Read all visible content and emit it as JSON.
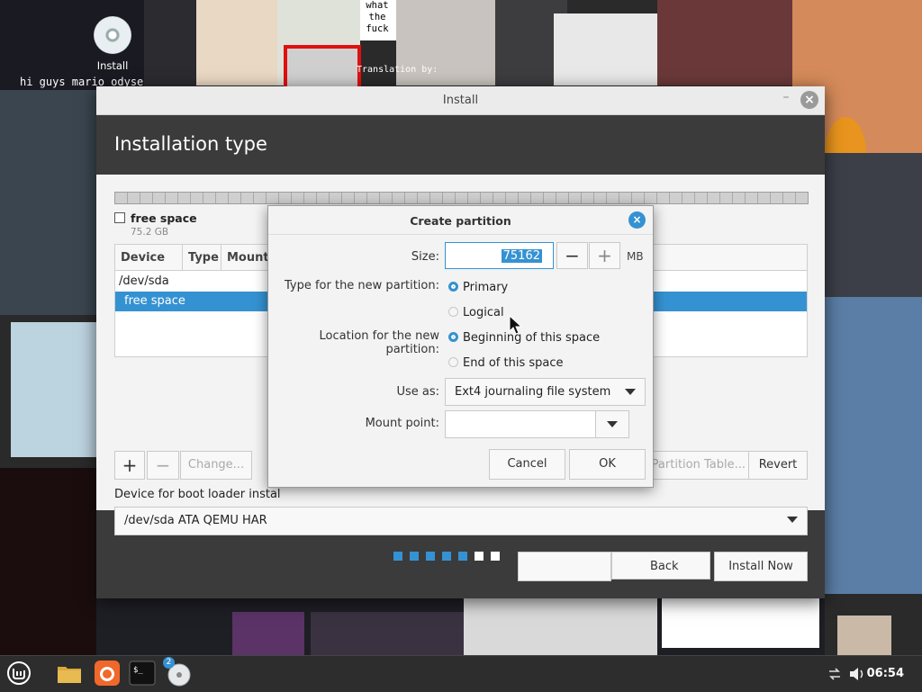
{
  "desktop": {
    "icon_label": "Install",
    "meme_text_1": "hi guys mario odyse",
    "meme_text_2": "what the fuck",
    "meme_text_3": "Translation by:"
  },
  "window": {
    "title": "Install",
    "minimize_glyph": "–",
    "close_glyph": "×",
    "page_title": "Installation type"
  },
  "partition": {
    "legend_name": "free space",
    "legend_size": "75.2 GB",
    "columns": [
      "Device",
      "Type",
      "Mount"
    ],
    "rows": [
      {
        "label": "/dev/sda"
      },
      {
        "label": "free space"
      }
    ],
    "buttons": {
      "add": "+",
      "remove": "−",
      "change": "Change...",
      "new_table": "Partition Table...",
      "revert": "Revert"
    }
  },
  "bootloader": {
    "label": "Device for boot loader instal",
    "value": "/dev/sda    ATA QEMU HAR"
  },
  "footer": {
    "back": "Back",
    "install_now": "Install Now"
  },
  "progress_dots": {
    "done_color": "#3592d2",
    "todo_color": "#ffffff",
    "done": 5,
    "total": 7
  },
  "dialog": {
    "title": "Create partition",
    "close_glyph": "×",
    "size_label": "Size:",
    "size_value": "75162",
    "minus": "−",
    "plus": "+",
    "unit": "MB",
    "type_label": "Type for the new partition:",
    "type_options": [
      {
        "label": "Primary",
        "checked": true
      },
      {
        "label": "Logical",
        "checked": false
      }
    ],
    "location_label": "Location for the new partition:",
    "location_options": [
      {
        "label": "Beginning of this space",
        "checked": true
      },
      {
        "label": "End of this space",
        "checked": false
      }
    ],
    "use_as_label": "Use as:",
    "use_as_value": "Ext4 journaling file system",
    "mount_label": "Mount point:",
    "mount_value": "",
    "cancel": "Cancel",
    "ok": "OK"
  },
  "taskbar": {
    "workspace_badge": "2",
    "clock": "06:54"
  },
  "colors": {
    "accent": "#3592d2",
    "window_header": "#3b3b3b"
  }
}
